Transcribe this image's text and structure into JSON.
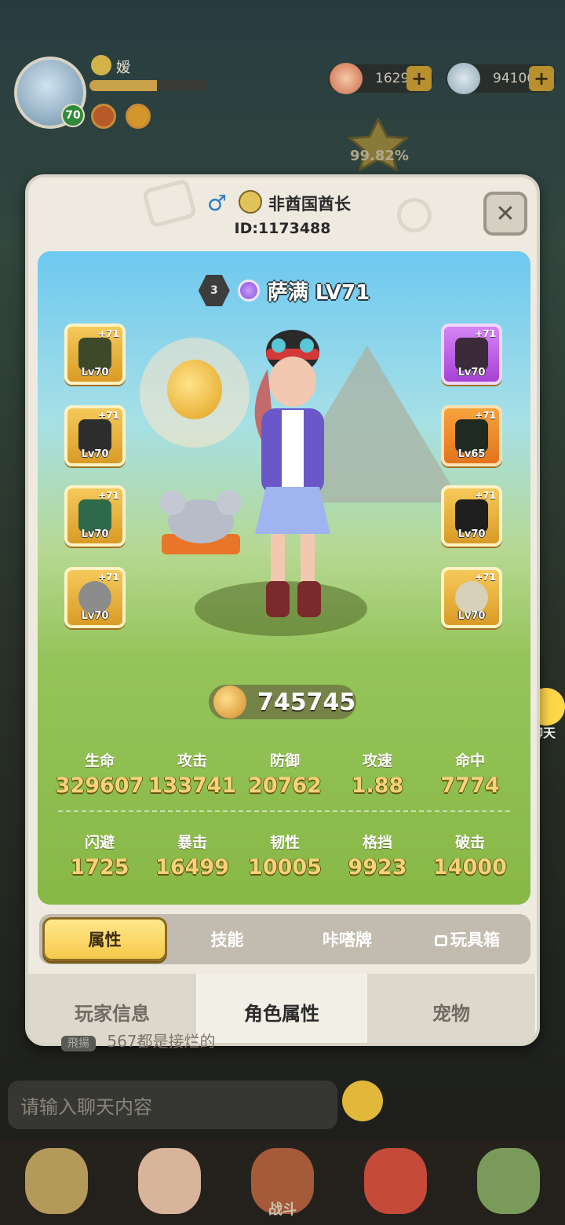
{
  "hud": {
    "player_name": "嫒",
    "level": "70",
    "xp_progress": 0.57,
    "currency1": "1629",
    "currency2": "94106",
    "rank_percent": "99.82%"
  },
  "dialog": {
    "title": "非酋国酋长",
    "id": "ID:1173488",
    "close_label": "✕"
  },
  "character": {
    "class_tier": "3",
    "name": "萨满 LV71",
    "power": "745745"
  },
  "equipment": {
    "left": [
      {
        "plus": "+71",
        "level": "Lv70"
      },
      {
        "plus": "+71",
        "level": "Lv70"
      },
      {
        "plus": "+71",
        "level": "Lv70"
      },
      {
        "plus": "+71",
        "level": "Lv70"
      }
    ],
    "right": [
      {
        "plus": "+71",
        "level": "Lv70"
      },
      {
        "plus": "+71",
        "level": "Lv65"
      },
      {
        "plus": "+71",
        "level": "Lv70"
      },
      {
        "plus": "+71",
        "level": "Lv70"
      }
    ]
  },
  "stats": {
    "row1": [
      {
        "label": "生命",
        "value": "329607"
      },
      {
        "label": "攻击",
        "value": "133741"
      },
      {
        "label": "防御",
        "value": "20762"
      },
      {
        "label": "攻速",
        "value": "1.88"
      },
      {
        "label": "命中",
        "value": "7774"
      }
    ],
    "row2": [
      {
        "label": "闪避",
        "value": "1725"
      },
      {
        "label": "暴击",
        "value": "16499"
      },
      {
        "label": "韧性",
        "value": "10005"
      },
      {
        "label": "格挡",
        "value": "9923"
      },
      {
        "label": "破击",
        "value": "14000"
      }
    ]
  },
  "inner_tabs": [
    "属性",
    "技能",
    "咔嗒牌",
    "玩具箱"
  ],
  "bottom_tabs": [
    "玩家信息",
    "角色属性",
    "宠物"
  ],
  "chat": {
    "bubble_label": "聊天",
    "sender": "飛揚",
    "last_message": "567都是接烂的",
    "input_placeholder": "请输入聊天内容"
  },
  "nav": {
    "center_label": "战斗"
  }
}
